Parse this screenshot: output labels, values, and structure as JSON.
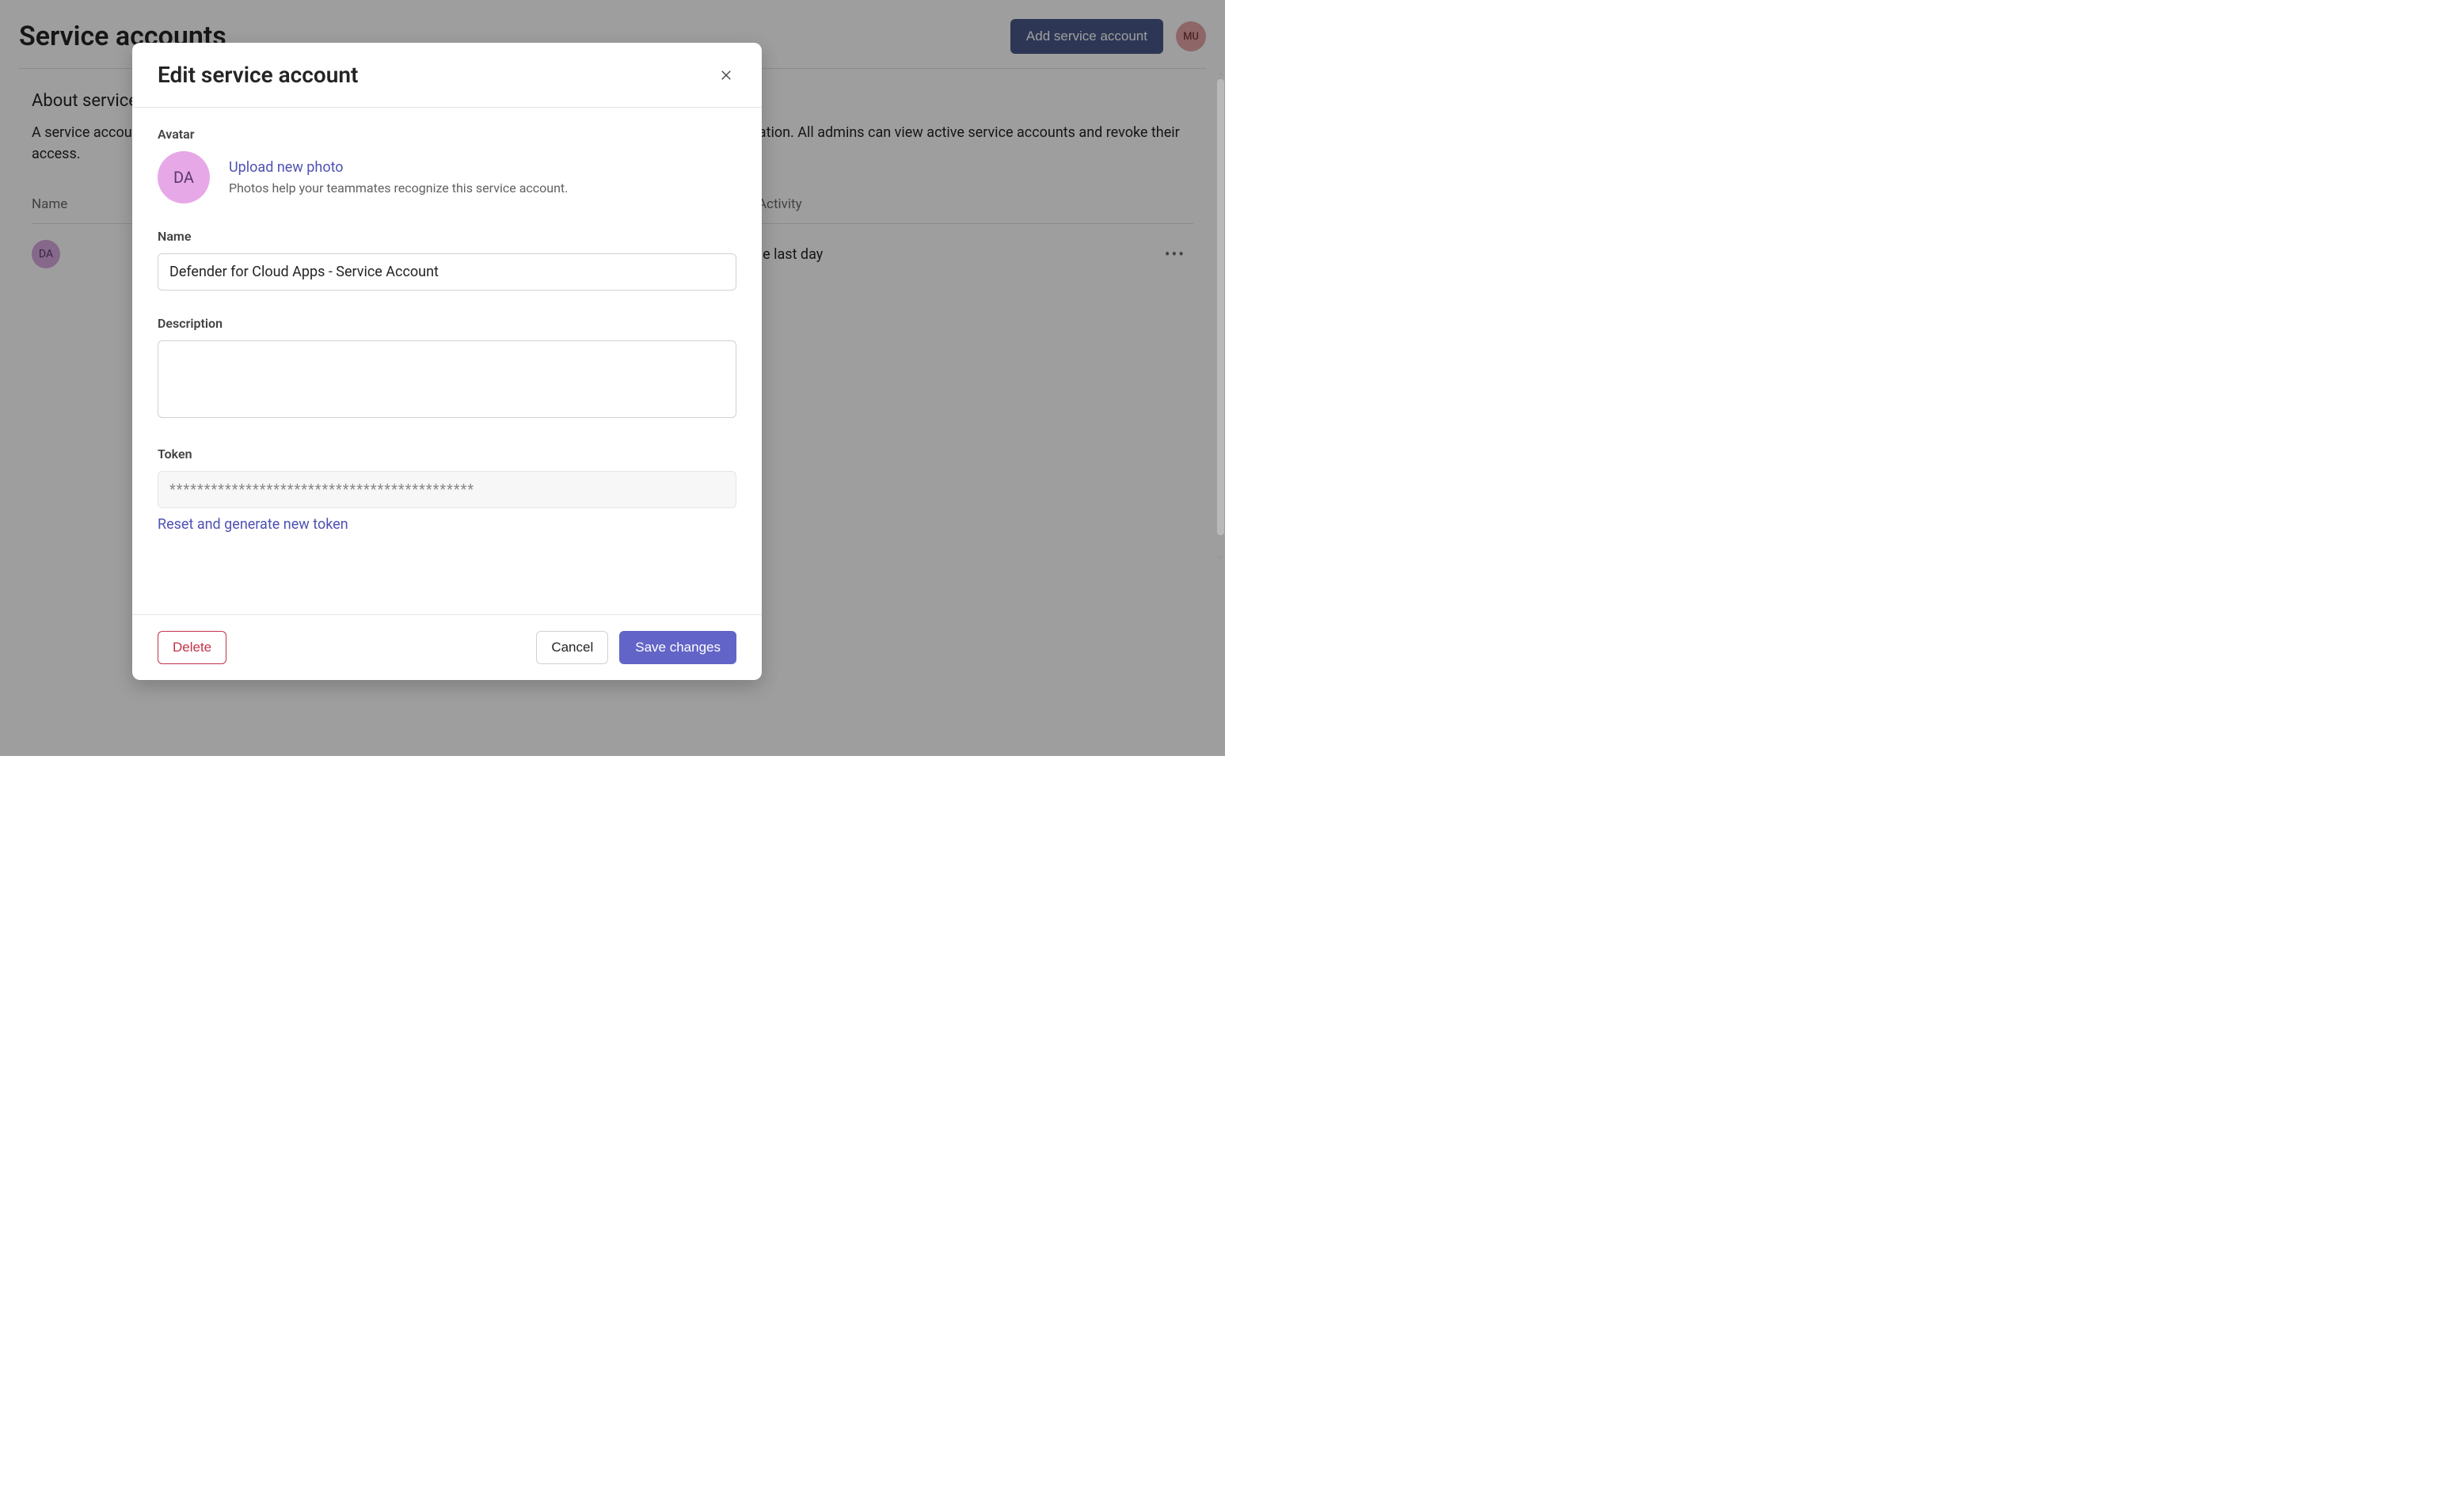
{
  "page": {
    "title": "Service accounts",
    "add_button": "Add service account",
    "user_initials": "MU",
    "section_title": "About service accounts",
    "section_desc": "A service account is a special type of account used by an application or service to access resources in your organization. All admins can view active service accounts and revoke their access.",
    "columns": {
      "name": "Name",
      "activity": "Last Activity"
    },
    "rows": [
      {
        "avatar_initials": "DA",
        "activity": "In the last day"
      }
    ]
  },
  "modal": {
    "title": "Edit service account",
    "avatar": {
      "label": "Avatar",
      "initials": "DA",
      "upload_link": "Upload new photo",
      "help": "Photos help your teammates recognize this service account."
    },
    "name": {
      "label": "Name",
      "value": "Defender for Cloud Apps - Service Account"
    },
    "description": {
      "label": "Description",
      "value": ""
    },
    "token": {
      "label": "Token",
      "value": "********************************************",
      "reset_link": "Reset and generate new token"
    },
    "footer": {
      "delete": "Delete",
      "cancel": "Cancel",
      "save": "Save changes"
    }
  }
}
